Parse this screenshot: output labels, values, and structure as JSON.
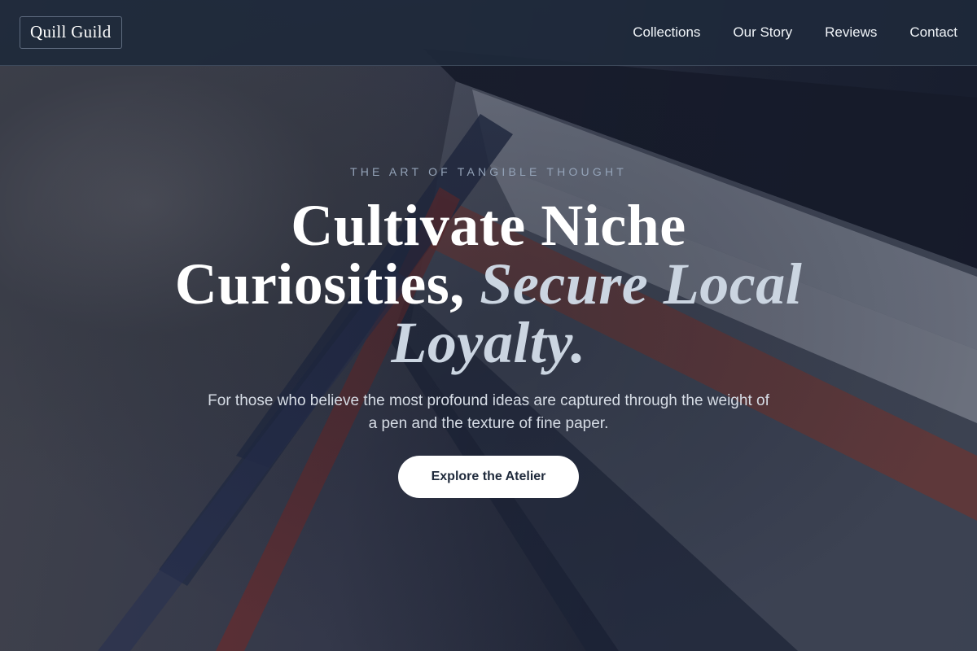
{
  "header": {
    "logo": "Quill Guild",
    "nav": [
      {
        "label": "Collections"
      },
      {
        "label": "Our Story"
      },
      {
        "label": "Reviews"
      },
      {
        "label": "Contact"
      }
    ]
  },
  "hero": {
    "eyebrow": "THE ART OF TANGIBLE THOUGHT",
    "headline_line1": "Cultivate Niche",
    "headline_line2_plain": "Curiosities,",
    "headline_accent": "Secure Local Loyalty.",
    "subtext": "For those who believe the most profound ideas are captured through the weight of a pen and the texture of fine paper.",
    "cta_label": "Explore the Atelier"
  },
  "colors": {
    "header_bg": "#1e293b",
    "accent_text": "#cbd5e1",
    "cta_bg": "#ffffff",
    "cta_text": "#1e293b"
  }
}
